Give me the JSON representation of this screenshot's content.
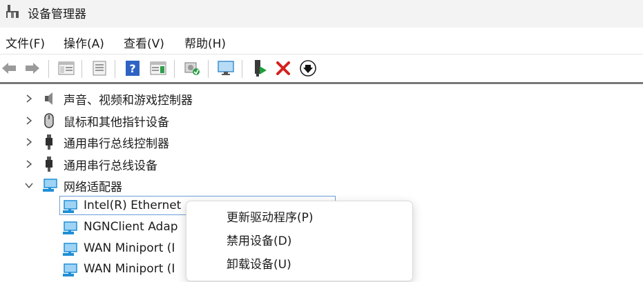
{
  "window": {
    "title": "设备管理器"
  },
  "menu": [
    "文件(F)",
    "操作(A)",
    "查看(V)",
    "帮助(H)"
  ],
  "toolbar": [
    "back-icon",
    "forward-icon",
    "show-hide-tree-icon",
    "properties-icon",
    "help-icon",
    "action-pane-icon",
    "scan-hardware-icon",
    "monitor-icon",
    "enable-device-icon",
    "uninstall-icon",
    "update-driver-icon"
  ],
  "tree": {
    "categories": [
      {
        "label": "声音、视频和游戏控制器",
        "icon": "speaker-icon",
        "expanded": false
      },
      {
        "label": "鼠标和其他指针设备",
        "icon": "mouse-icon",
        "expanded": false
      },
      {
        "label": "通用串行总线控制器",
        "icon": "usb-icon",
        "expanded": false
      },
      {
        "label": "通用串行总线设备",
        "icon": "usb-icon",
        "expanded": false
      },
      {
        "label": "网络适配器",
        "icon": "network-adapter-icon",
        "expanded": true
      }
    ],
    "adapters": [
      "Intel(R) Ethernet",
      "NGNClient Adap",
      "WAN Miniport (I",
      "WAN Miniport (I"
    ]
  },
  "context_menu": [
    "更新驱动程序(P)",
    "禁用设备(D)",
    "卸载设备(U)"
  ],
  "colors": {
    "selection_border": "#6a9fd7",
    "network_icon": "#1f8fd6",
    "uninstall_red": "#d4201f",
    "enable_green": "#1f9d3a"
  }
}
